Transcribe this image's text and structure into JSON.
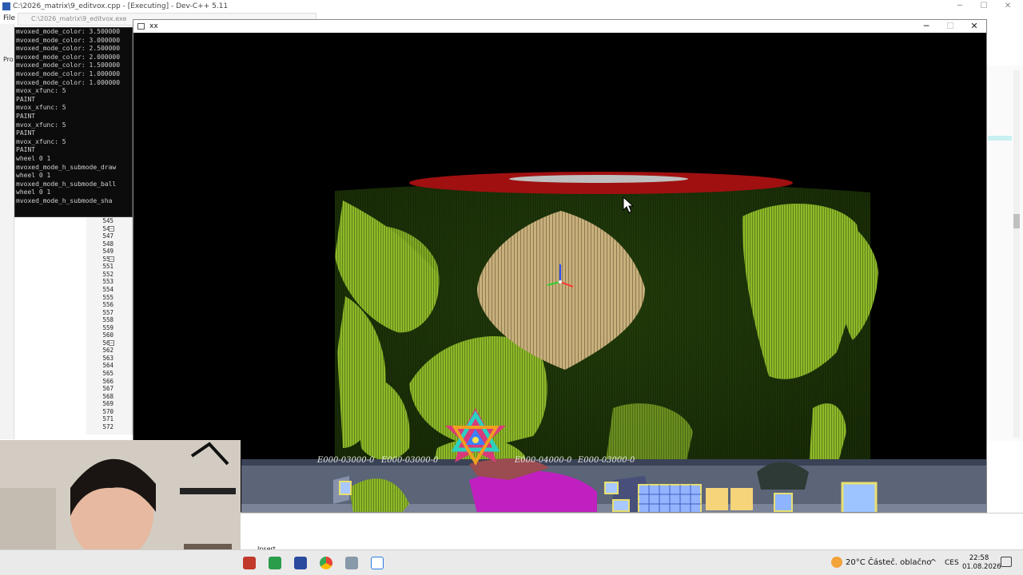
{
  "ide": {
    "title": "C:\\2026_matrix\\9_editvox.cpp - [Executing] - Dev-C++ 5.11",
    "exe_title": "C:\\2026_matrix\\9_editvox.exe",
    "menu_file": "File",
    "panel_label": "Pro",
    "status_mode": "Insert",
    "line_numbers": [
      "545",
      "546",
      "547",
      "548",
      "549",
      "550",
      "551",
      "552",
      "553",
      "554",
      "555",
      "556",
      "557",
      "558",
      "559",
      "560",
      "561",
      "562",
      "563",
      "564",
      "565",
      "566",
      "567",
      "568",
      "569",
      "570",
      "571",
      "572"
    ],
    "window_buttons": {
      "minimize": "─",
      "maximize": "☐",
      "close": "✕"
    }
  },
  "console": {
    "lines": [
      "mvoxed_mode_color: 3.500000",
      "mvoxed_mode_color: 3.000000",
      "mvoxed_mode_color: 2.500000",
      "mvoxed_mode_color: 2.000000",
      "mvoxed_mode_color: 1.500000",
      "mvoxed_mode_color: 1.000000",
      "mvoxed_mode_color: 1.000000",
      "mvox_xfunc: 5",
      "PAINT",
      "mvox_xfunc: 5",
      "PAINT",
      "mvox_xfunc: 5",
      "PAINT",
      "mvox_xfunc: 5",
      "PAINT",
      "wheel 0 1",
      "mvoxed_mode_h_submode_draw",
      "wheel 0 1",
      "mvoxed_mode_h_submode_ball",
      "wheel 0 1",
      "mvoxed_mode_h_submode_sha"
    ]
  },
  "game": {
    "title": "xx",
    "window_buttons": {
      "minimize": "─",
      "maximize": "☐",
      "close": "✕"
    },
    "hud_counters": [
      "E000-03000-0",
      "E000-03000-0",
      "E000-04000-0",
      "E000-03000-0"
    ],
    "colors": {
      "voxel_green": "#8fb82a",
      "voxel_tan": "#c8b07c",
      "cylinder_red": "#a01010",
      "hud_panel": "#6f7890",
      "magenta": "#c020c0"
    }
  },
  "taskbar": {
    "weather": "20°C  Částeč. oblačno",
    "language": "CES",
    "time": "22:58",
    "date": "01.08.2026",
    "chevron": "^"
  }
}
